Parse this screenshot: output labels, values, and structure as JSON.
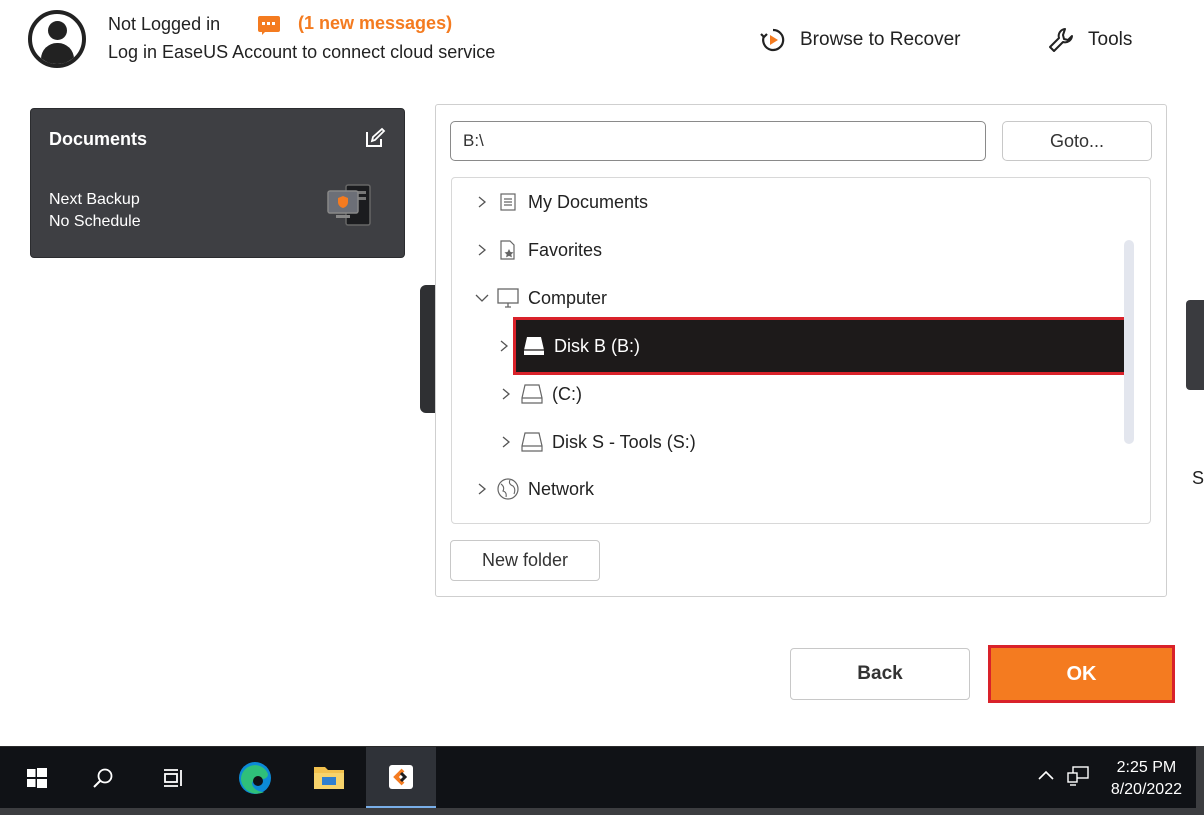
{
  "header": {
    "login_title": "Not Logged in",
    "new_messages": "(1 new messages)",
    "login_subtitle": "Log in EaseUS Account to connect cloud service",
    "browse_to_recover": "Browse to Recover",
    "tools": "Tools"
  },
  "backup_card": {
    "title": "Documents",
    "next_backup_label": "Next Backup",
    "schedule": "No Schedule"
  },
  "background": {
    "partial_text": "S"
  },
  "dialog": {
    "path_value": "B:\\",
    "goto_label": "Goto...",
    "tree": [
      {
        "label": "My Documents",
        "icon": "document-list-icon",
        "expanded": false
      },
      {
        "label": "Favorites",
        "icon": "favorites-icon",
        "expanded": false
      },
      {
        "label": "Computer",
        "icon": "monitor-icon",
        "expanded": true
      },
      {
        "label": "Disk B (B:)",
        "icon": "drive-icon",
        "expanded": false,
        "selected": true
      },
      {
        "label": "(C:)",
        "icon": "drive-icon",
        "expanded": false
      },
      {
        "label": "Disk S - Tools (S:)",
        "icon": "drive-icon",
        "expanded": false
      },
      {
        "label": "Network",
        "icon": "globe-icon",
        "expanded": false
      }
    ],
    "new_folder_label": "New folder",
    "back_label": "Back",
    "ok_label": "OK"
  },
  "taskbar": {
    "time": "2:25 PM",
    "date": "8/20/2022",
    "apps": [
      "start-icon",
      "search-icon",
      "task-view-icon",
      "edge-icon",
      "file-explorer-icon",
      "easeus-todo-backup-icon"
    ]
  },
  "colors": {
    "accent": "#f47b20",
    "selection_outline": "#d9222a",
    "card_bg": "#3e3f43",
    "taskbar_bg": "#101216"
  }
}
